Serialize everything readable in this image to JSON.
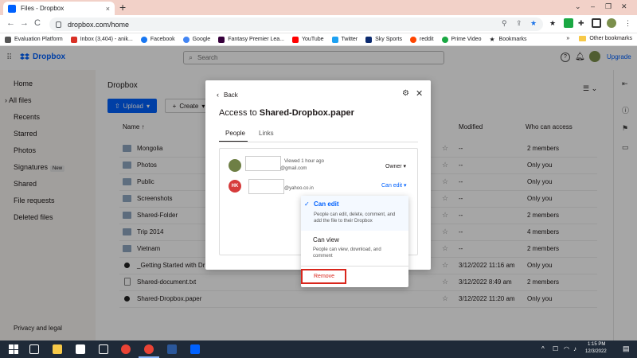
{
  "browser": {
    "tab_title": "Files - Dropbox",
    "tab_close": "×",
    "new_tab": "+",
    "url": "dropbox.com/home",
    "nav_back": "←",
    "nav_forward": "→",
    "nav_reload": "C"
  },
  "bookmarks": {
    "items": [
      {
        "label": "Evaluation Platform",
        "color": "#555555"
      },
      {
        "label": "Inbox (3,404) - anik...",
        "color": "#d93025"
      },
      {
        "label": "Facebook",
        "color": "#1877f2"
      },
      {
        "label": "Google",
        "color": "#4285f4"
      },
      {
        "label": "Fantasy Premier Lea...",
        "color": "#37003c"
      },
      {
        "label": "YouTube",
        "color": "#ff0000"
      },
      {
        "label": "Twitter",
        "color": "#1da1f2"
      },
      {
        "label": "Sky Sports",
        "color": "#0b2a6f"
      },
      {
        "label": "reddit",
        "color": "#ff4500"
      },
      {
        "label": "Prime Video",
        "color": "#1aa843"
      },
      {
        "label": "Bookmarks",
        "color": "#202124"
      }
    ],
    "more": "»",
    "other": "Other bookmarks"
  },
  "dropbox_header": {
    "logo": "Dropbox",
    "search_placeholder": "Search",
    "upgrade": "Upgrade"
  },
  "sidebar": {
    "items": [
      {
        "label": "Home"
      },
      {
        "label": "All files"
      },
      {
        "label": "Recents"
      },
      {
        "label": "Starred"
      },
      {
        "label": "Photos"
      },
      {
        "label": "Signatures",
        "badge": "New"
      },
      {
        "label": "Shared"
      },
      {
        "label": "File requests"
      },
      {
        "label": "Deleted files"
      }
    ],
    "footer": "Privacy and legal"
  },
  "main": {
    "breadcrumb": "Dropbox",
    "upload": "Upload",
    "create": "Create",
    "columns": {
      "name": "Name",
      "modified": "Modified",
      "access": "Who can access"
    },
    "rows": [
      {
        "name": "Mongolia",
        "modified": "--",
        "access": "2 members",
        "kind": "shared"
      },
      {
        "name": "Photos",
        "modified": "--",
        "access": "Only you",
        "kind": "folder"
      },
      {
        "name": "Public",
        "modified": "--",
        "access": "Only you",
        "kind": "folder"
      },
      {
        "name": "Screenshots",
        "modified": "--",
        "access": "Only you",
        "kind": "folder"
      },
      {
        "name": "Shared-Folder",
        "modified": "--",
        "access": "2 members",
        "kind": "shared"
      },
      {
        "name": "Trip 2014",
        "modified": "--",
        "access": "4 members",
        "kind": "shared"
      },
      {
        "name": "Vietnam",
        "modified": "--",
        "access": "2 members",
        "kind": "shared"
      },
      {
        "name": "_Getting Started with Dr",
        "modified": "3/12/2022 11:16 am",
        "access": "Only you",
        "kind": "paper"
      },
      {
        "name": "Shared-document.txt",
        "modified": "3/12/2022 8:49 am",
        "access": "2 members",
        "kind": "doc"
      },
      {
        "name": "Shared-Dropbox.paper",
        "modified": "3/12/2022 11:20 am",
        "access": "Only you",
        "kind": "paper"
      }
    ]
  },
  "modal": {
    "back": "Back",
    "title_prefix": "Access to ",
    "title_file": "Shared-Dropbox.paper",
    "tab_people": "People",
    "tab_links": "Links",
    "members": [
      {
        "initials": "",
        "viewed": "Viewed 1 hour ago",
        "email": "@gmail.com",
        "role": "Owner ▾"
      },
      {
        "initials": "HK",
        "email": "@yahoo.co.in",
        "role": "Can edit ▾"
      }
    ]
  },
  "role_menu": {
    "can_edit": "Can edit",
    "can_edit_desc": "People can edit, delete, comment, and add the file to their Dropbox",
    "can_view": "Can view",
    "can_view_desc": "People can view, download, and comment",
    "remove": "Remove"
  },
  "taskbar": {
    "time": "1:15 PM",
    "date": "12/3/2022"
  }
}
